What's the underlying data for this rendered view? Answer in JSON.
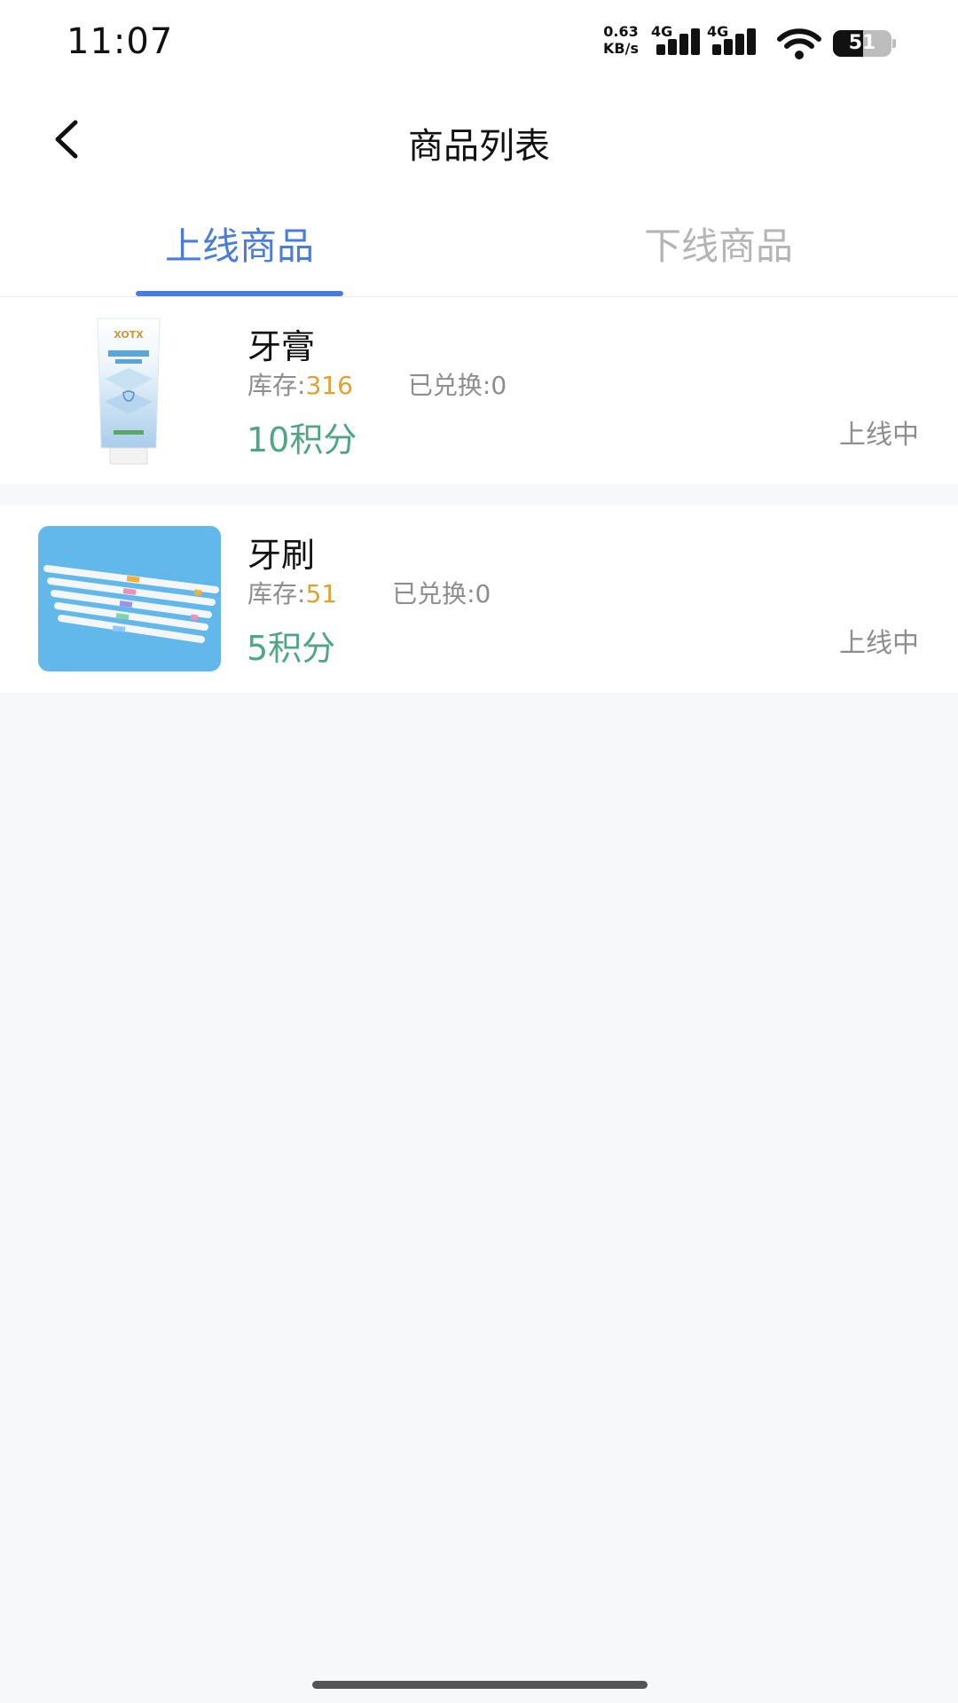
{
  "status_bar": {
    "time": "11:07",
    "net_speed_value": "0.63",
    "net_speed_unit": "KB/s",
    "sim1_label": "4G",
    "sim2_label": "4G",
    "battery_level": 51,
    "battery_text": "51"
  },
  "header": {
    "title": "商品列表",
    "back_icon": "chevron-left-icon"
  },
  "tabs": [
    {
      "label": "上线商品",
      "active": true
    },
    {
      "label": "下线商品",
      "active": false
    }
  ],
  "products": [
    {
      "name": "牙膏",
      "stock_label": "库存:",
      "stock": "316",
      "exchanged_label": "已兑换:",
      "exchanged": "0",
      "points": "10积分",
      "status": "上线中",
      "brand_on_image": "XOTX"
    },
    {
      "name": "牙刷",
      "stock_label": "库存:",
      "stock": "51",
      "exchanged_label": "已兑换:",
      "exchanged": "0",
      "points": "5积分",
      "status": "上线中"
    }
  ],
  "colors": {
    "accent": "#4a7ddb",
    "stock_number": "#e0a22f",
    "points": "#4fa584",
    "muted": "#8d8d8d"
  }
}
